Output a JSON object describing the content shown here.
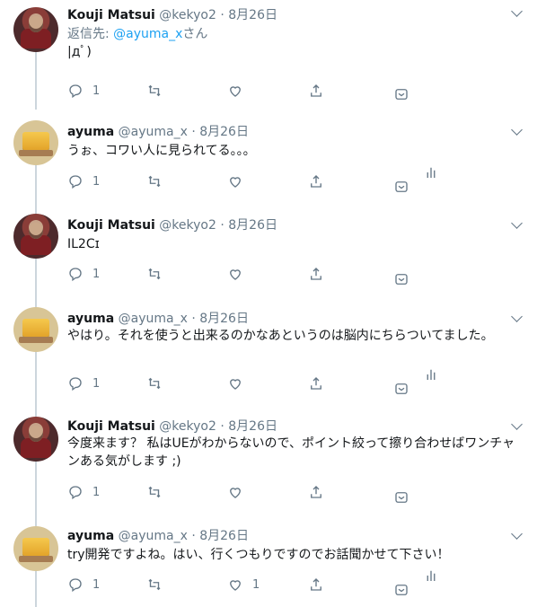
{
  "tweets": [
    {
      "name": "Kouji Matsui",
      "handle": "@kekyo2",
      "sep": "·",
      "date": "8月26日",
      "avatar": "kouji",
      "reply_prefix": "返信先: ",
      "reply_mention": "@ayuma_x",
      "reply_suffix": "さん",
      "text": "|дﾟ)",
      "reply_count": "1",
      "like_count": "",
      "analytics": false
    },
    {
      "name": "ayuma",
      "handle": "@ayuma_x",
      "sep": "·",
      "date": "8月26日",
      "avatar": "ayuma",
      "text": "うぉ、コワい人に見られてる。。。",
      "reply_count": "1",
      "like_count": "",
      "analytics": true
    },
    {
      "name": "Kouji Matsui",
      "handle": "@kekyo2",
      "sep": "·",
      "date": "8月26日",
      "avatar": "kouji",
      "text": "IL2Cɪ",
      "reply_count": "1",
      "like_count": "",
      "analytics": false
    },
    {
      "name": "ayuma",
      "handle": "@ayuma_x",
      "sep": "·",
      "date": "8月26日",
      "avatar": "ayuma",
      "text": "やはり。それを使うと出来るのかなあというのは脳内にちらついてました。",
      "reply_count": "1",
      "like_count": "",
      "analytics": true
    },
    {
      "name": "Kouji Matsui",
      "handle": "@kekyo2",
      "sep": "·",
      "date": "8月26日",
      "avatar": "kouji",
      "text": "今度来ます？ 私はUEがわからないので、ポイント絞って擦り合わせばワンチャンある気がします ;)",
      "reply_count": "1",
      "like_count": "",
      "analytics": false
    },
    {
      "name": "ayuma",
      "handle": "@ayuma_x",
      "sep": "·",
      "date": "8月26日",
      "avatar": "ayuma",
      "text": "try開発ですよね。はい、行くつもりですのでお話聞かせて下さい！",
      "reply_count": "1",
      "like_count": "1",
      "analytics": true
    }
  ],
  "icons": {
    "reply": "reply-icon",
    "retweet": "retweet-icon",
    "like": "like-icon",
    "share": "share-icon",
    "dm": "dm-icon",
    "analytics": "analytics-icon",
    "more": "chevron-down-icon"
  },
  "colors": {
    "link": "#1da1f2",
    "muted": "#657786",
    "thread": "#ccd6dd"
  }
}
